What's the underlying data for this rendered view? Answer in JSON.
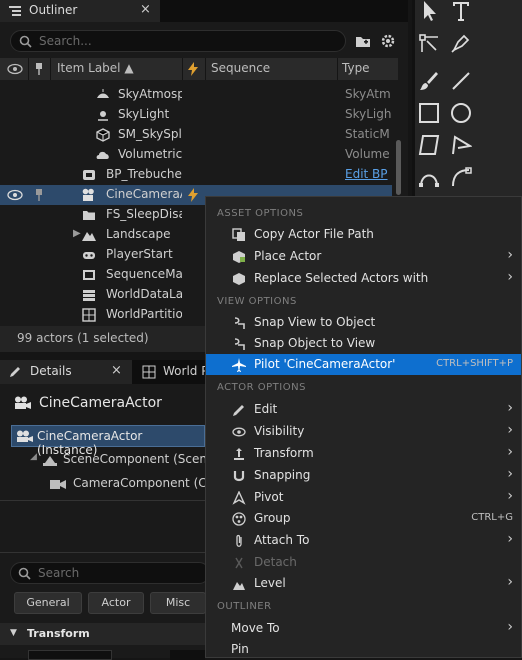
{
  "outliner": {
    "tab_label": "Outliner",
    "close": "×",
    "search_placeholder": "Search...",
    "columns": {
      "item_label": "Item Label ▲",
      "sequence": "Sequence",
      "type": "Type"
    },
    "rows": [
      {
        "label": "SkyAtmosp",
        "type": "SkyAtm",
        "indent": 2,
        "icon": "sky-atmosphere-icon"
      },
      {
        "label": "SkyLight",
        "type": "SkyLigh",
        "indent": 2,
        "icon": "skylight-icon"
      },
      {
        "label": "SM_SkySpl",
        "type": "StaticM",
        "indent": 2,
        "icon": "static-mesh-icon"
      },
      {
        "label": "Volumetric(",
        "type": "Volume",
        "indent": 2,
        "icon": "volumetric-cloud-icon"
      },
      {
        "label": "BP_Trebuche",
        "type": "Edit BP",
        "indent": 1,
        "icon": "blueprint-icon"
      },
      {
        "label": "CineCameraA",
        "type": "",
        "indent": 1,
        "icon": "camera-icon",
        "selected": true
      },
      {
        "label": "FS_SleepDisa",
        "type": "",
        "indent": 1,
        "icon": "folder-icon"
      },
      {
        "label": "Landscape",
        "type": "",
        "indent": 1,
        "icon": "landscape-icon"
      },
      {
        "label": "PlayerStart",
        "type": "",
        "indent": 1,
        "icon": "player-start-icon"
      },
      {
        "label": "SequenceMas",
        "type": "",
        "indent": 1,
        "icon": "sequence-icon"
      },
      {
        "label": "WorldDataLay",
        "type": "",
        "indent": 1,
        "icon": "data-layer-icon"
      },
      {
        "label": "WorldPartition",
        "type": "",
        "indent": 1,
        "icon": "world-partition-icon"
      }
    ],
    "status": "99 actors (1 selected)"
  },
  "details": {
    "tab_label": "Details",
    "close": "×",
    "world_tab": "World P",
    "actor_name": "CineCameraActor",
    "instance": "CineCameraActor (Instance)",
    "components": [
      "SceneComponent (Scene",
      "CameraComponent (Ca"
    ],
    "search_placeholder": "Search",
    "filters": [
      "General",
      "Actor",
      "Misc"
    ],
    "section": "Transform"
  },
  "menu": {
    "sections": {
      "asset": "ASSET OPTIONS",
      "view": "VIEW OPTIONS",
      "actor": "ACTOR OPTIONS",
      "outliner": "OUTLINER"
    },
    "items": {
      "copy_path": "Copy Actor File Path",
      "place_actor": "Place Actor",
      "replace": "Replace Selected Actors with",
      "snap_view": "Snap View to Object",
      "snap_object": "Snap Object to View",
      "pilot": "Pilot 'CineCameraActor'",
      "pilot_shortcut": "CTRL+SHIFT+P",
      "edit": "Edit",
      "visibility": "Visibility",
      "transform": "Transform",
      "snapping": "Snapping",
      "pivot": "Pivot",
      "group": "Group",
      "group_shortcut": "CTRL+G",
      "attach": "Attach To",
      "detach": "Detach",
      "level": "Level",
      "move_to": "Move To",
      "pin": "Pin"
    },
    "arrow": "›"
  },
  "colors": {
    "highlight": "#0e6fcf",
    "selected_row": "#2d4a6b"
  }
}
